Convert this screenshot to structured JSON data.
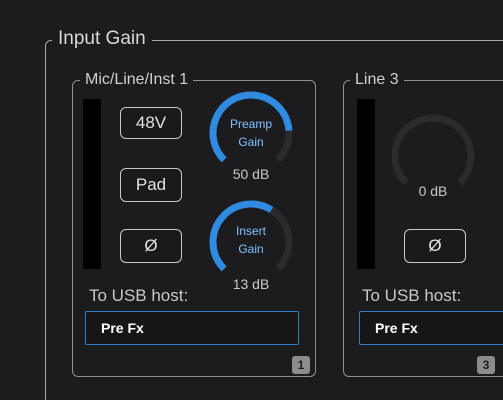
{
  "group": {
    "title": "Input Gain"
  },
  "channels": [
    {
      "title": "Mic/Line/Inst 1",
      "buttons": {
        "phantom": "48V",
        "pad": "Pad",
        "phase": "Ø"
      },
      "preamp_gain": {
        "label_line1": "Preamp",
        "label_line2": "Gain",
        "value": "50 dB",
        "level": 0.82
      },
      "insert_gain": {
        "label_line1": "Insert",
        "label_line2": "Gain",
        "value": "13 dB",
        "level": 0.62
      },
      "usb": {
        "label": "To USB host:",
        "selected": "Pre Fx"
      },
      "badge": "1"
    },
    {
      "title": "Line 3",
      "gain": {
        "value": "0 dB",
        "level": 0
      },
      "buttons": {
        "phase": "Ø"
      },
      "usb": {
        "label": "To USB host:",
        "selected": "Pre Fx"
      },
      "badge": "3"
    }
  ],
  "colors": {
    "accent": "#2f8ae0",
    "knob_track": "#2b2b2b",
    "label_blue": "#7fc2ff",
    "background": "#1c1c1e"
  }
}
